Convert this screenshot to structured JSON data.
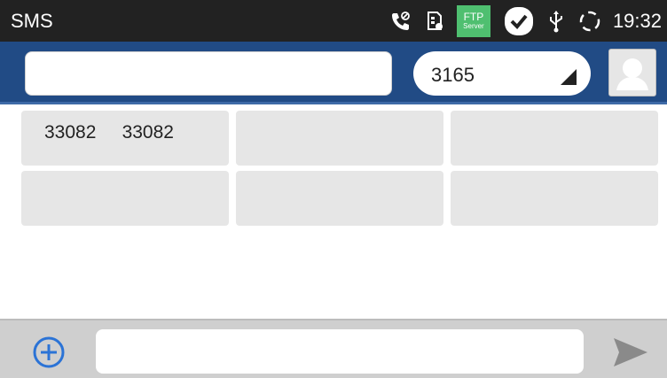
{
  "status_bar": {
    "title": "SMS",
    "ftp_label": "FTP",
    "ftp_sub": "Server",
    "time": "19:32"
  },
  "toolbar": {
    "recipient_value": "",
    "account_selected": "3165"
  },
  "suggestions": [
    {
      "text": "33082     33082"
    },
    {
      "text": ""
    },
    {
      "text": ""
    },
    {
      "text": ""
    },
    {
      "text": ""
    },
    {
      "text": ""
    }
  ],
  "compose": {
    "message_value": ""
  },
  "colors": {
    "status_bar_bg": "#222222",
    "toolbar_bg": "#214b85",
    "accent_blue": "#2b73d6",
    "ftp_green": "#4fbf70",
    "cell_bg": "#e6e6e6",
    "compose_bg": "#cfcfcf"
  },
  "icons": {
    "call": "call-forward-icon",
    "sim": "sim-card-icon",
    "ftp": "ftp-server-icon",
    "check": "check-icon",
    "usb": "usb-icon",
    "sync": "sync-icon",
    "contact": "contact-icon",
    "add": "add-circle-icon",
    "send": "send-icon"
  }
}
